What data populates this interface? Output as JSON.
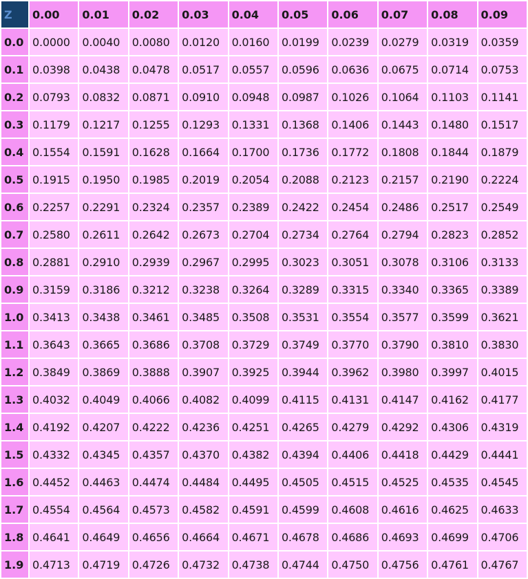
{
  "table": {
    "corner_label": "Z",
    "column_headers": [
      "0.00",
      "0.01",
      "0.02",
      "0.03",
      "0.04",
      "0.05",
      "0.06",
      "0.07",
      "0.08",
      "0.09"
    ],
    "rows": [
      {
        "z": "0.0",
        "values": [
          "0.0000",
          "0.0040",
          "0.0080",
          "0.0120",
          "0.0160",
          "0.0199",
          "0.0239",
          "0.0279",
          "0.0319",
          "0.0359"
        ]
      },
      {
        "z": "0.1",
        "values": [
          "0.0398",
          "0.0438",
          "0.0478",
          "0.0517",
          "0.0557",
          "0.0596",
          "0.0636",
          "0.0675",
          "0.0714",
          "0.0753"
        ]
      },
      {
        "z": "0.2",
        "values": [
          "0.0793",
          "0.0832",
          "0.0871",
          "0.0910",
          "0.0948",
          "0.0987",
          "0.1026",
          "0.1064",
          "0.1103",
          "0.1141"
        ]
      },
      {
        "z": "0.3",
        "values": [
          "0.1179",
          "0.1217",
          "0.1255",
          "0.1293",
          "0.1331",
          "0.1368",
          "0.1406",
          "0.1443",
          "0.1480",
          "0.1517"
        ]
      },
      {
        "z": "0.4",
        "values": [
          "0.1554",
          "0.1591",
          "0.1628",
          "0.1664",
          "0.1700",
          "0.1736",
          "0.1772",
          "0.1808",
          "0.1844",
          "0.1879"
        ]
      },
      {
        "z": "0.5",
        "values": [
          "0.1915",
          "0.1950",
          "0.1985",
          "0.2019",
          "0.2054",
          "0.2088",
          "0.2123",
          "0.2157",
          "0.2190",
          "0.2224"
        ]
      },
      {
        "z": "0.6",
        "values": [
          "0.2257",
          "0.2291",
          "0.2324",
          "0.2357",
          "0.2389",
          "0.2422",
          "0.2454",
          "0.2486",
          "0.2517",
          "0.2549"
        ]
      },
      {
        "z": "0.7",
        "values": [
          "0.2580",
          "0.2611",
          "0.2642",
          "0.2673",
          "0.2704",
          "0.2734",
          "0.2764",
          "0.2794",
          "0.2823",
          "0.2852"
        ]
      },
      {
        "z": "0.8",
        "values": [
          "0.2881",
          "0.2910",
          "0.2939",
          "0.2967",
          "0.2995",
          "0.3023",
          "0.3051",
          "0.3078",
          "0.3106",
          "0.3133"
        ]
      },
      {
        "z": "0.9",
        "values": [
          "0.3159",
          "0.3186",
          "0.3212",
          "0.3238",
          "0.3264",
          "0.3289",
          "0.3315",
          "0.3340",
          "0.3365",
          "0.3389"
        ]
      },
      {
        "z": "1.0",
        "values": [
          "0.3413",
          "0.3438",
          "0.3461",
          "0.3485",
          "0.3508",
          "0.3531",
          "0.3554",
          "0.3577",
          "0.3599",
          "0.3621"
        ]
      },
      {
        "z": "1.1",
        "values": [
          "0.3643",
          "0.3665",
          "0.3686",
          "0.3708",
          "0.3729",
          "0.3749",
          "0.3770",
          "0.3790",
          "0.3810",
          "0.3830"
        ]
      },
      {
        "z": "1.2",
        "values": [
          "0.3849",
          "0.3869",
          "0.3888",
          "0.3907",
          "0.3925",
          "0.3944",
          "0.3962",
          "0.3980",
          "0.3997",
          "0.4015"
        ]
      },
      {
        "z": "1.3",
        "values": [
          "0.4032",
          "0.4049",
          "0.4066",
          "0.4082",
          "0.4099",
          "0.4115",
          "0.4131",
          "0.4147",
          "0.4162",
          "0.4177"
        ]
      },
      {
        "z": "1.4",
        "values": [
          "0.4192",
          "0.4207",
          "0.4222",
          "0.4236",
          "0.4251",
          "0.4265",
          "0.4279",
          "0.4292",
          "0.4306",
          "0.4319"
        ]
      },
      {
        "z": "1.5",
        "values": [
          "0.4332",
          "0.4345",
          "0.4357",
          "0.4370",
          "0.4382",
          "0.4394",
          "0.4406",
          "0.4418",
          "0.4429",
          "0.4441"
        ]
      },
      {
        "z": "1.6",
        "values": [
          "0.4452",
          "0.4463",
          "0.4474",
          "0.4484",
          "0.4495",
          "0.4505",
          "0.4515",
          "0.4525",
          "0.4535",
          "0.4545"
        ]
      },
      {
        "z": "1.7",
        "values": [
          "0.4554",
          "0.4564",
          "0.4573",
          "0.4582",
          "0.4591",
          "0.4599",
          "0.4608",
          "0.4616",
          "0.4625",
          "0.4633"
        ]
      },
      {
        "z": "1.8",
        "values": [
          "0.4641",
          "0.4649",
          "0.4656",
          "0.4664",
          "0.4671",
          "0.4678",
          "0.4686",
          "0.4693",
          "0.4699",
          "0.4706"
        ]
      },
      {
        "z": "1.9",
        "values": [
          "0.4713",
          "0.4719",
          "0.4726",
          "0.4732",
          "0.4738",
          "0.4744",
          "0.4750",
          "0.4756",
          "0.4761",
          "0.4767"
        ]
      }
    ]
  },
  "colors": {
    "corner_bg": "#17416b",
    "corner_text": "#5b8fd0",
    "header_bg": "#f596f5",
    "cell_bg": "#ffc8ff",
    "text": "#1a1a1a"
  }
}
